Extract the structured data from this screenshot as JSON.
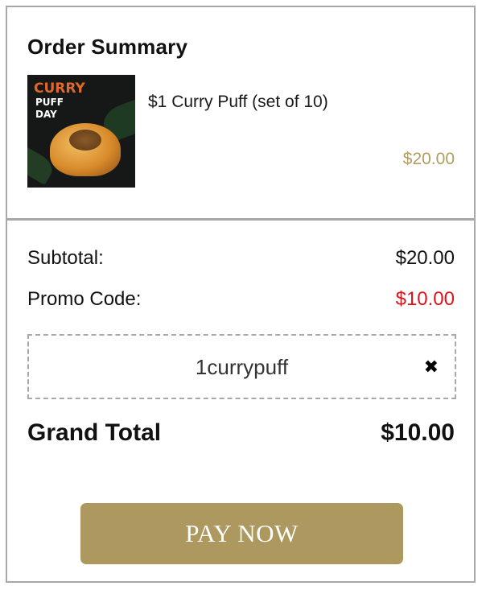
{
  "summary": {
    "title": "Order Summary",
    "item": {
      "image_text": [
        "CURRY",
        "PUFF",
        "DAY"
      ],
      "name": "$1 Curry Puff (set of 10)",
      "price": "$20.00"
    }
  },
  "totals": {
    "subtotal_label": "Subtotal:",
    "subtotal_value": "$20.00",
    "promo_label": "Promo Code:",
    "promo_value": "$10.00",
    "promo_code": "1currypuff",
    "remove_icon": "close-icon",
    "grand_label": "Grand Total",
    "grand_value": "$10.00"
  },
  "actions": {
    "pay_label": "PAY NOW"
  },
  "colors": {
    "accent": "#ad9960",
    "price_muted": "#b09d60",
    "discount": "#e0121a",
    "border": "#a8a8a8"
  }
}
